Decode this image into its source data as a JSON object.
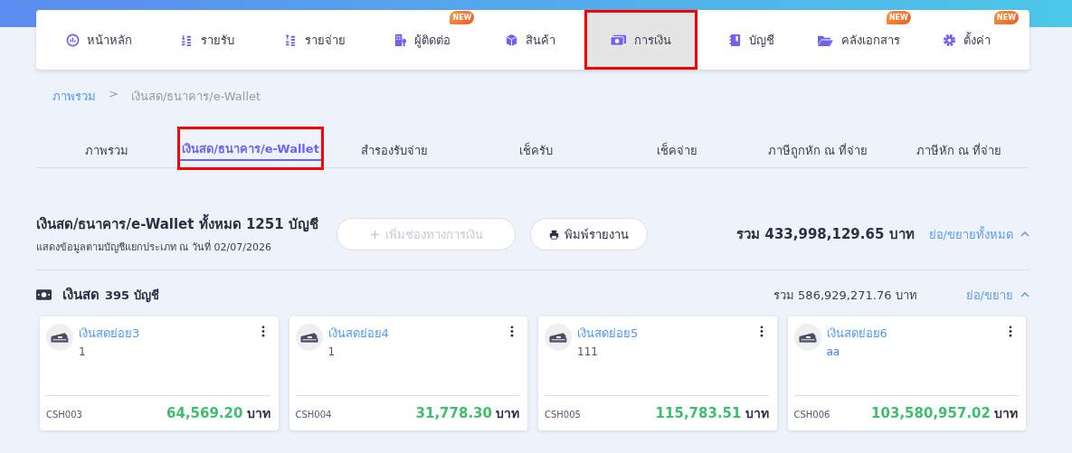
{
  "nav": {
    "items": [
      {
        "label": "หน้าหลัก",
        "selected": false,
        "highlighted": false
      },
      {
        "label": "รายรับ",
        "selected": false,
        "highlighted": false
      },
      {
        "label": "รายจ่าย",
        "selected": false,
        "highlighted": false
      },
      {
        "label": "ผู้ติดต่อ",
        "selected": false,
        "highlighted": false,
        "badge": "NEW"
      },
      {
        "label": "สินค้า",
        "selected": false,
        "highlighted": false
      },
      {
        "label": "การเงิน",
        "selected": true,
        "highlighted": true
      },
      {
        "label": "บัญชี",
        "selected": false,
        "highlighted": false
      },
      {
        "label": "คลังเอกสาร",
        "selected": false,
        "highlighted": false,
        "badge": "NEW"
      },
      {
        "label": "ตั้งค่า",
        "selected": false,
        "highlighted": false,
        "badge": "NEW"
      }
    ]
  },
  "breadcrumb": [
    {
      "label": "ภาพรวม",
      "link": true
    },
    {
      "label": ">",
      "link": false
    },
    {
      "label": "เงินสด/ธนาคาร/e-Wallet",
      "link": false
    }
  ],
  "tabs": [
    {
      "label": "ภาพรวม",
      "selected": false,
      "highlighted": false
    },
    {
      "label": "เงินสด/ธนาคาร/e-Wallet",
      "selected": true,
      "highlighted": true
    },
    {
      "label": "สำรองรับจ่าย",
      "selected": false,
      "highlighted": false
    },
    {
      "label": "เช็ครับ",
      "selected": false,
      "highlighted": false
    },
    {
      "label": "เช็คจ่าย",
      "selected": false,
      "highlighted": false
    },
    {
      "label": "ภาษีถูกหัก ณ ที่จ่าย",
      "selected": false,
      "highlighted": false
    },
    {
      "label": "ภาษีหัก ณ ที่จ่าย",
      "selected": false,
      "highlighted": false
    }
  ],
  "summary": {
    "title": "เงินสด/ธนาคาร/e-Wallet ทั้งหมด 1251 บัญชี",
    "subtitle": "แสดงข้อมูลตามบัญชีแยกประเภท ณ วันที่ 02/07/2026",
    "buttons": [
      {
        "label": "เพิ่มช่องทางการเงิน",
        "kind": "add",
        "disabled": true
      },
      {
        "label": "พิมพ์รายงาน",
        "kind": "print",
        "disabled": false
      }
    ],
    "total": "รวม 433,998,129.65 บาท",
    "toggle": "ย่อ/ขยายทั้งหมด",
    "expanded": true
  },
  "sections": [
    {
      "title": "เงินสด",
      "count": "395 บัญชี",
      "total": "รวม 586,929,271.76 บาท",
      "toggle": "ย่อ/ขยาย",
      "expanded": true,
      "cards": [
        {
          "name": "เงินสดย่อย3",
          "note": "1",
          "color": "#6b4a55",
          "code": "CSH003",
          "amount": "64,569.20",
          "currency": "บาท"
        },
        {
          "name": "เงินสดย่อย4",
          "note": "1",
          "color": "#6b4a55",
          "code": "CSH004",
          "amount": "31,778.30",
          "currency": "บาท"
        },
        {
          "name": "เงินสดย่อย5",
          "note": "111",
          "color": "#6b4a55",
          "code": "CSH005",
          "amount": "115,783.51",
          "currency": "บาท"
        },
        {
          "name": "เงินสดย่อย6",
          "note": "aa",
          "color": "#3f7fe0",
          "code": "CSH006",
          "amount": "103,580,957.02",
          "currency": "บาท"
        }
      ]
    }
  ]
}
